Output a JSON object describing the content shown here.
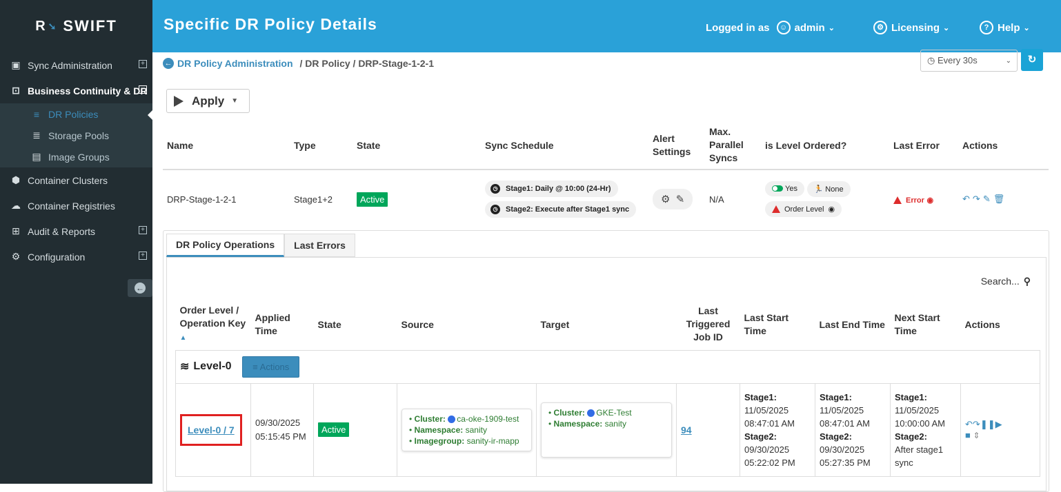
{
  "app": {
    "logo_text": "SWIFT",
    "logo_mark": "R"
  },
  "header": {
    "title": "Specific DR Policy Details",
    "logged_in_as": "Logged in as",
    "user": "admin",
    "licensing": "Licensing",
    "help": "Help"
  },
  "sidebar": {
    "items": [
      {
        "label": "Sync Administration"
      },
      {
        "label": "Business Continuity & DR"
      },
      {
        "label": "DR Policies"
      },
      {
        "label": "Storage Pools"
      },
      {
        "label": "Image Groups"
      },
      {
        "label": "Container Clusters"
      },
      {
        "label": "Container Registries"
      },
      {
        "label": "Audit & Reports"
      },
      {
        "label": "Configuration"
      }
    ]
  },
  "breadcrumb": {
    "root": "DR Policy Administration",
    "rest": "/  DR Policy / DRP-Stage-1-2-1"
  },
  "refresh": {
    "selected": "Every 30s"
  },
  "apply": {
    "label": "Apply"
  },
  "policy_table": {
    "headers": {
      "name": "Name",
      "type": "Type",
      "state": "State",
      "sync_schedule": "Sync Schedule",
      "alert_1": "Alert",
      "alert_2": "Settings",
      "max_1": "Max.",
      "max_2": "Parallel",
      "max_3": "Syncs",
      "level_ordered": "is Level Ordered?",
      "last_error": "Last Error",
      "actions": "Actions"
    },
    "row": {
      "name": "DRP-Stage-1-2-1",
      "type": "Stage1+2",
      "state": "Active",
      "schedule1": "Stage1: Daily @ 10:00 (24-Hr)",
      "schedule2": "Stage2: Execute after Stage1 sync",
      "max_parallel": "N/A",
      "level_yes": "Yes",
      "level_none": "None",
      "order_level": "Order Level",
      "last_error": "Error"
    }
  },
  "tabs": {
    "ops": "DR Policy Operations",
    "errors": "Last Errors"
  },
  "search": {
    "label": "Search..."
  },
  "ops_table": {
    "headers": {
      "order_1": "Order Level /",
      "order_2": "Operation Key",
      "applied_1": "Applied",
      "applied_2": "Time",
      "state": "State",
      "source": "Source",
      "target": "Target",
      "ltj_1": "Last",
      "ltj_2": "Triggered",
      "ltj_3": "Job ID",
      "lst_1": "Last Start",
      "lst_2": "Time",
      "let": "Last End Time",
      "nst_1": "Next Start",
      "nst_2": "Time",
      "actions": "Actions"
    },
    "level": {
      "label": "Level-0",
      "actions": "Actions"
    },
    "row": {
      "key": "Level-0 / 7",
      "applied_date": "09/30/2025",
      "applied_time": "05:15:45 PM",
      "state": "Active",
      "source": {
        "cluster_k": "Cluster:",
        "cluster": "ca-oke-1909-test",
        "ns_k": "Namespace:",
        "ns": "sanity",
        "ig_k": "Imagegroup:",
        "ig": "sanity-ir-mapp"
      },
      "target": {
        "cluster_k": "Cluster:",
        "cluster": "GKE-Test",
        "ns_k": "Namespace:",
        "ns": "sanity"
      },
      "job_id": "94",
      "last_start": {
        "s1": "Stage1:",
        "d1": "11/05/2025",
        "t1": "08:47:01 AM",
        "s2": "Stage2:",
        "d2": "09/30/2025",
        "t2": "05:22:02 PM"
      },
      "last_end": {
        "s1": "Stage1:",
        "d1": "11/05/2025",
        "t1": "08:47:01 AM",
        "s2": "Stage2:",
        "d2": "09/30/2025",
        "t2": "05:27:35 PM"
      },
      "next_start": {
        "s1": "Stage1:",
        "d1": "11/05/2025",
        "t1": "10:00:00 AM",
        "s2": "Stage2:",
        "l1": "After stage1",
        "l2": "sync"
      }
    }
  },
  "colors": {
    "accent": "#2aa1d8",
    "link": "#3c8dbc",
    "active": "#00a65a",
    "error": "#dd2c2c",
    "sidebar": "#222d32"
  }
}
